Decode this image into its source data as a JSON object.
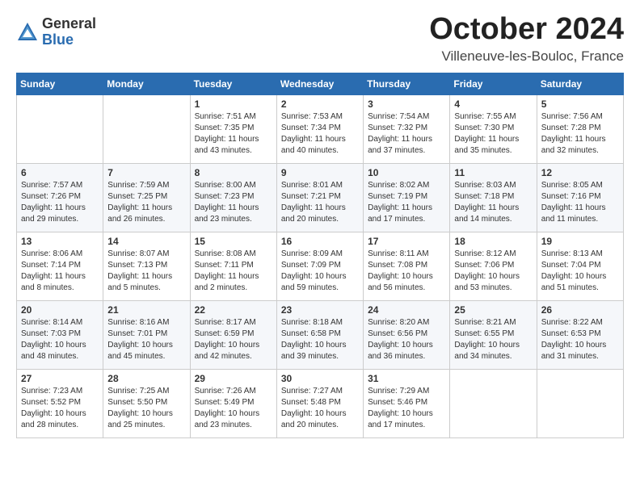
{
  "header": {
    "logo_general": "General",
    "logo_blue": "Blue",
    "month_title": "October 2024",
    "location": "Villeneuve-les-Bouloc, France"
  },
  "weekdays": [
    "Sunday",
    "Monday",
    "Tuesday",
    "Wednesday",
    "Thursday",
    "Friday",
    "Saturday"
  ],
  "weeks": [
    [
      {
        "day": "",
        "info": ""
      },
      {
        "day": "",
        "info": ""
      },
      {
        "day": "1",
        "info": "Sunrise: 7:51 AM\nSunset: 7:35 PM\nDaylight: 11 hours and 43 minutes."
      },
      {
        "day": "2",
        "info": "Sunrise: 7:53 AM\nSunset: 7:34 PM\nDaylight: 11 hours and 40 minutes."
      },
      {
        "day": "3",
        "info": "Sunrise: 7:54 AM\nSunset: 7:32 PM\nDaylight: 11 hours and 37 minutes."
      },
      {
        "day": "4",
        "info": "Sunrise: 7:55 AM\nSunset: 7:30 PM\nDaylight: 11 hours and 35 minutes."
      },
      {
        "day": "5",
        "info": "Sunrise: 7:56 AM\nSunset: 7:28 PM\nDaylight: 11 hours and 32 minutes."
      }
    ],
    [
      {
        "day": "6",
        "info": "Sunrise: 7:57 AM\nSunset: 7:26 PM\nDaylight: 11 hours and 29 minutes."
      },
      {
        "day": "7",
        "info": "Sunrise: 7:59 AM\nSunset: 7:25 PM\nDaylight: 11 hours and 26 minutes."
      },
      {
        "day": "8",
        "info": "Sunrise: 8:00 AM\nSunset: 7:23 PM\nDaylight: 11 hours and 23 minutes."
      },
      {
        "day": "9",
        "info": "Sunrise: 8:01 AM\nSunset: 7:21 PM\nDaylight: 11 hours and 20 minutes."
      },
      {
        "day": "10",
        "info": "Sunrise: 8:02 AM\nSunset: 7:19 PM\nDaylight: 11 hours and 17 minutes."
      },
      {
        "day": "11",
        "info": "Sunrise: 8:03 AM\nSunset: 7:18 PM\nDaylight: 11 hours and 14 minutes."
      },
      {
        "day": "12",
        "info": "Sunrise: 8:05 AM\nSunset: 7:16 PM\nDaylight: 11 hours and 11 minutes."
      }
    ],
    [
      {
        "day": "13",
        "info": "Sunrise: 8:06 AM\nSunset: 7:14 PM\nDaylight: 11 hours and 8 minutes."
      },
      {
        "day": "14",
        "info": "Sunrise: 8:07 AM\nSunset: 7:13 PM\nDaylight: 11 hours and 5 minutes."
      },
      {
        "day": "15",
        "info": "Sunrise: 8:08 AM\nSunset: 7:11 PM\nDaylight: 11 hours and 2 minutes."
      },
      {
        "day": "16",
        "info": "Sunrise: 8:09 AM\nSunset: 7:09 PM\nDaylight: 10 hours and 59 minutes."
      },
      {
        "day": "17",
        "info": "Sunrise: 8:11 AM\nSunset: 7:08 PM\nDaylight: 10 hours and 56 minutes."
      },
      {
        "day": "18",
        "info": "Sunrise: 8:12 AM\nSunset: 7:06 PM\nDaylight: 10 hours and 53 minutes."
      },
      {
        "day": "19",
        "info": "Sunrise: 8:13 AM\nSunset: 7:04 PM\nDaylight: 10 hours and 51 minutes."
      }
    ],
    [
      {
        "day": "20",
        "info": "Sunrise: 8:14 AM\nSunset: 7:03 PM\nDaylight: 10 hours and 48 minutes."
      },
      {
        "day": "21",
        "info": "Sunrise: 8:16 AM\nSunset: 7:01 PM\nDaylight: 10 hours and 45 minutes."
      },
      {
        "day": "22",
        "info": "Sunrise: 8:17 AM\nSunset: 6:59 PM\nDaylight: 10 hours and 42 minutes."
      },
      {
        "day": "23",
        "info": "Sunrise: 8:18 AM\nSunset: 6:58 PM\nDaylight: 10 hours and 39 minutes."
      },
      {
        "day": "24",
        "info": "Sunrise: 8:20 AM\nSunset: 6:56 PM\nDaylight: 10 hours and 36 minutes."
      },
      {
        "day": "25",
        "info": "Sunrise: 8:21 AM\nSunset: 6:55 PM\nDaylight: 10 hours and 34 minutes."
      },
      {
        "day": "26",
        "info": "Sunrise: 8:22 AM\nSunset: 6:53 PM\nDaylight: 10 hours and 31 minutes."
      }
    ],
    [
      {
        "day": "27",
        "info": "Sunrise: 7:23 AM\nSunset: 5:52 PM\nDaylight: 10 hours and 28 minutes."
      },
      {
        "day": "28",
        "info": "Sunrise: 7:25 AM\nSunset: 5:50 PM\nDaylight: 10 hours and 25 minutes."
      },
      {
        "day": "29",
        "info": "Sunrise: 7:26 AM\nSunset: 5:49 PM\nDaylight: 10 hours and 23 minutes."
      },
      {
        "day": "30",
        "info": "Sunrise: 7:27 AM\nSunset: 5:48 PM\nDaylight: 10 hours and 20 minutes."
      },
      {
        "day": "31",
        "info": "Sunrise: 7:29 AM\nSunset: 5:46 PM\nDaylight: 10 hours and 17 minutes."
      },
      {
        "day": "",
        "info": ""
      },
      {
        "day": "",
        "info": ""
      }
    ]
  ]
}
